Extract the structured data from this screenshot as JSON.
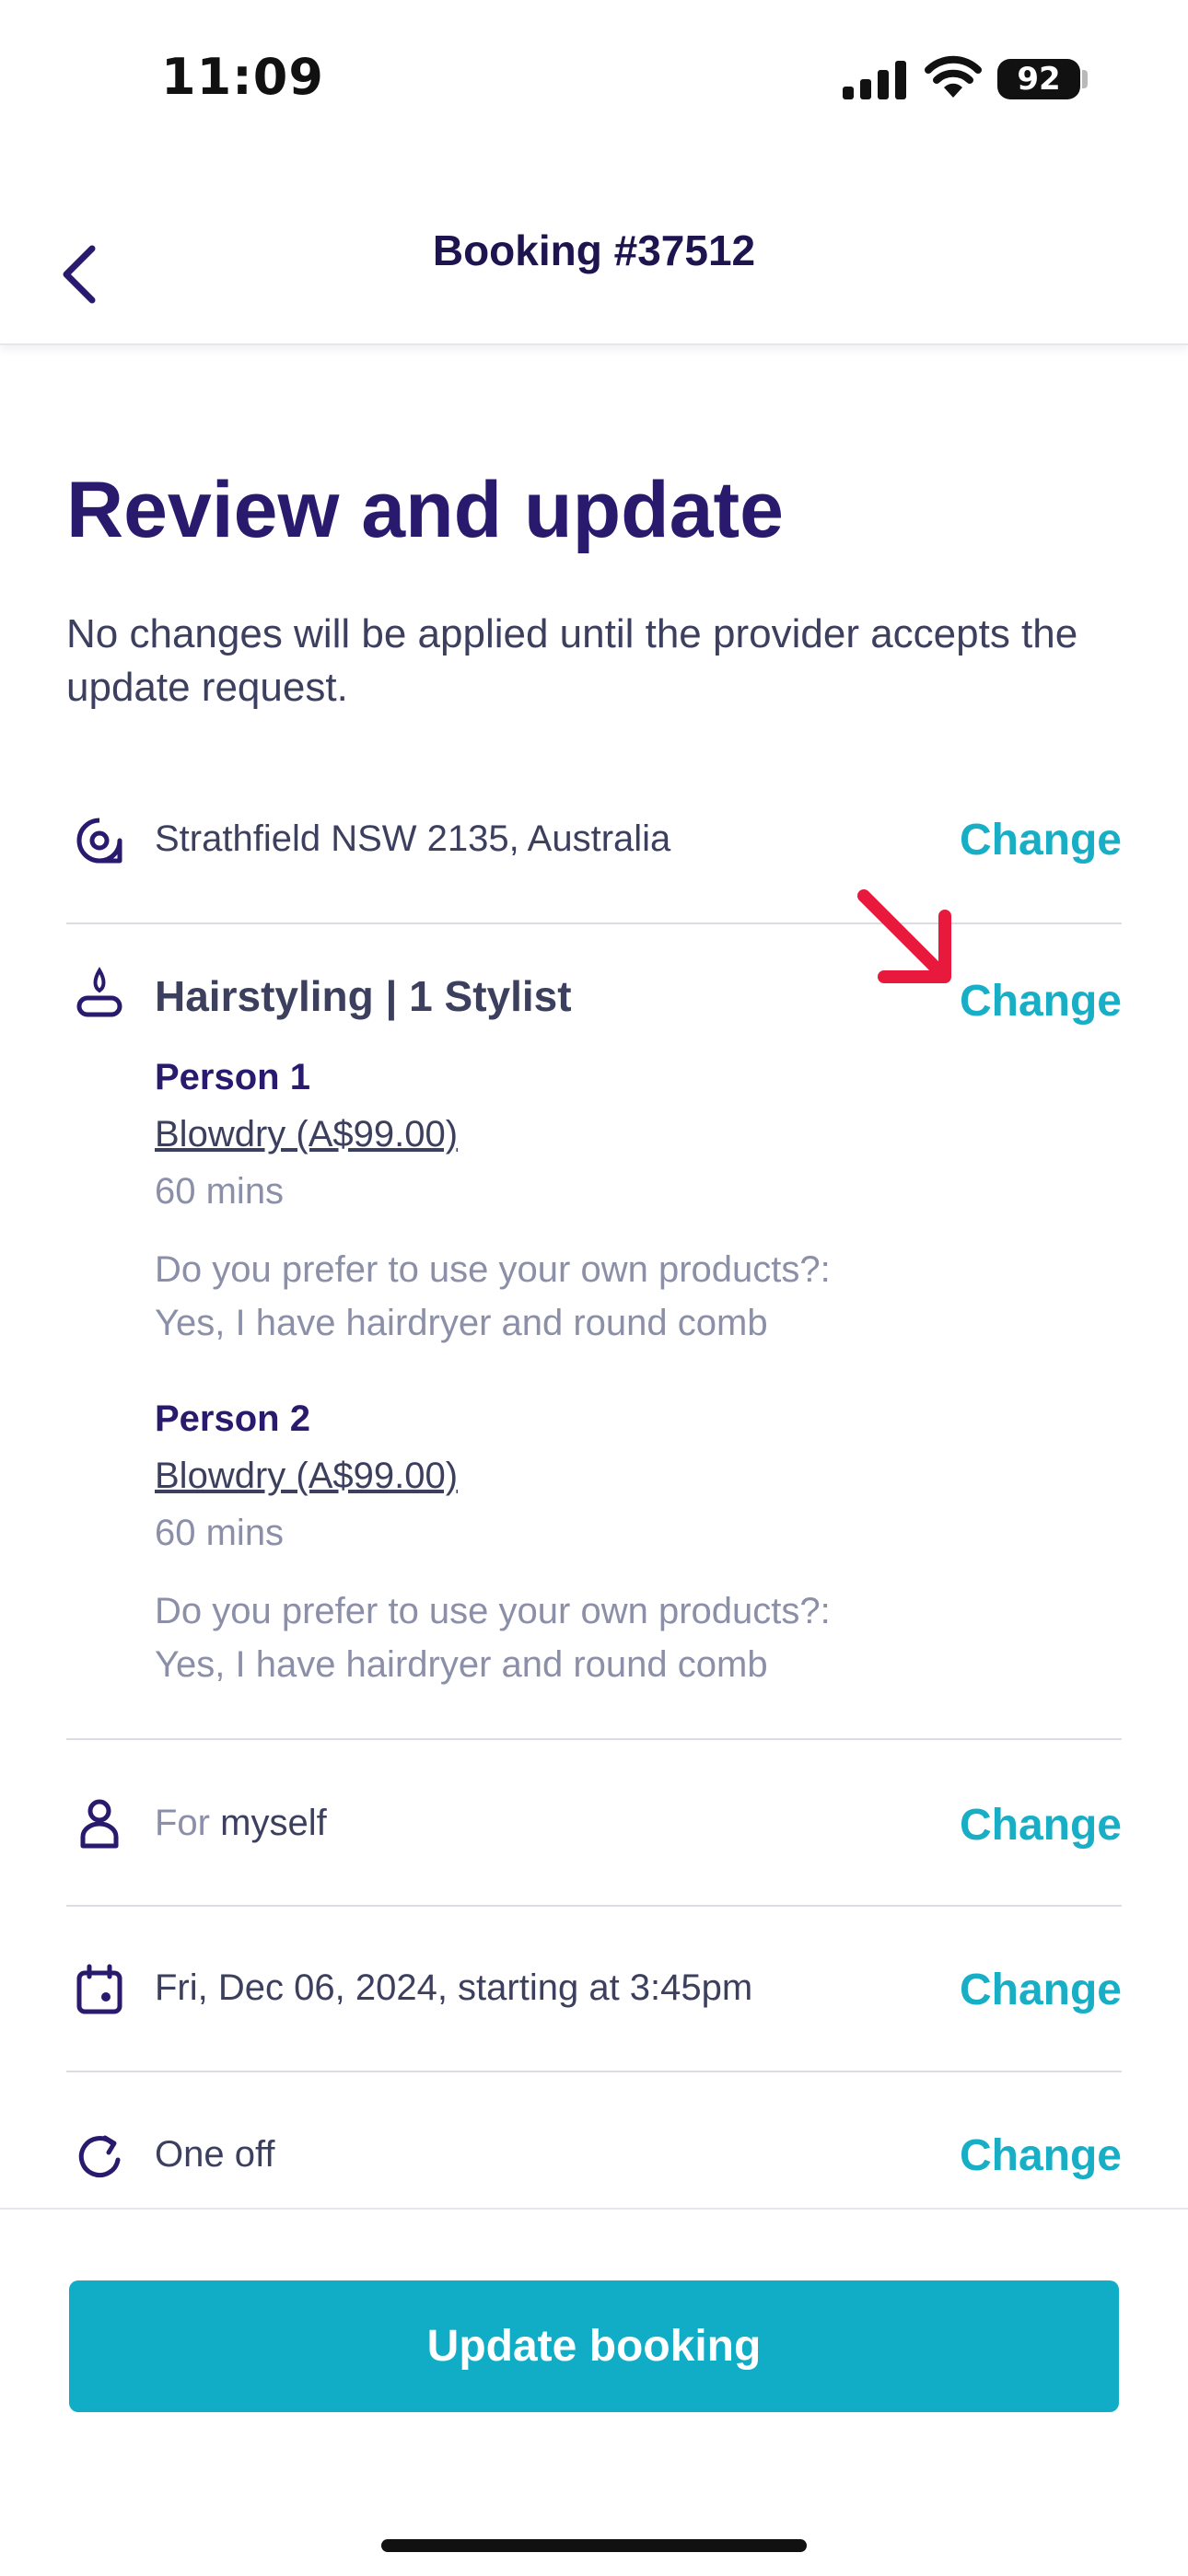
{
  "status": {
    "time": "11:09",
    "battery": "92"
  },
  "header": {
    "title": "Booking #37512"
  },
  "page": {
    "title": "Review and update",
    "subtitle": "No changes will be applied until the provider accepts the update request."
  },
  "location": {
    "text": "Strathfield NSW 2135, Australia",
    "change_label": "Change"
  },
  "service": {
    "title": "Hairstyling | 1 Stylist",
    "change_label": "Change",
    "persons": [
      {
        "label": "Person 1",
        "service": "Blowdry (A$99.00)",
        "duration": "60 mins",
        "question": "Do you prefer to use your own products?:",
        "answer": "Yes, I have hairdryer and round comb"
      },
      {
        "label": "Person 2",
        "service": "Blowdry (A$99.00)",
        "duration": "60 mins",
        "question": "Do you prefer to use your own products?:",
        "answer": "Yes, I have hairdryer and round comb"
      }
    ]
  },
  "recipient": {
    "prefix": "For",
    "value": "myself",
    "change_label": "Change"
  },
  "datetime": {
    "text": "Fri, Dec 06, 2024, starting at 3:45pm",
    "change_label": "Change"
  },
  "frequency": {
    "text": "One off",
    "change_label": "Change"
  },
  "footer": {
    "button_label": "Update booking"
  },
  "colors": {
    "accent": "#18aec5",
    "brand": "#2a1a6e",
    "button": "#11adc6",
    "annotation_arrow": "#e8193c"
  },
  "icons": [
    "back-chevron-icon",
    "location-pin-icon",
    "treatment-icon",
    "person-icon",
    "calendar-icon",
    "repeat-icon"
  ]
}
